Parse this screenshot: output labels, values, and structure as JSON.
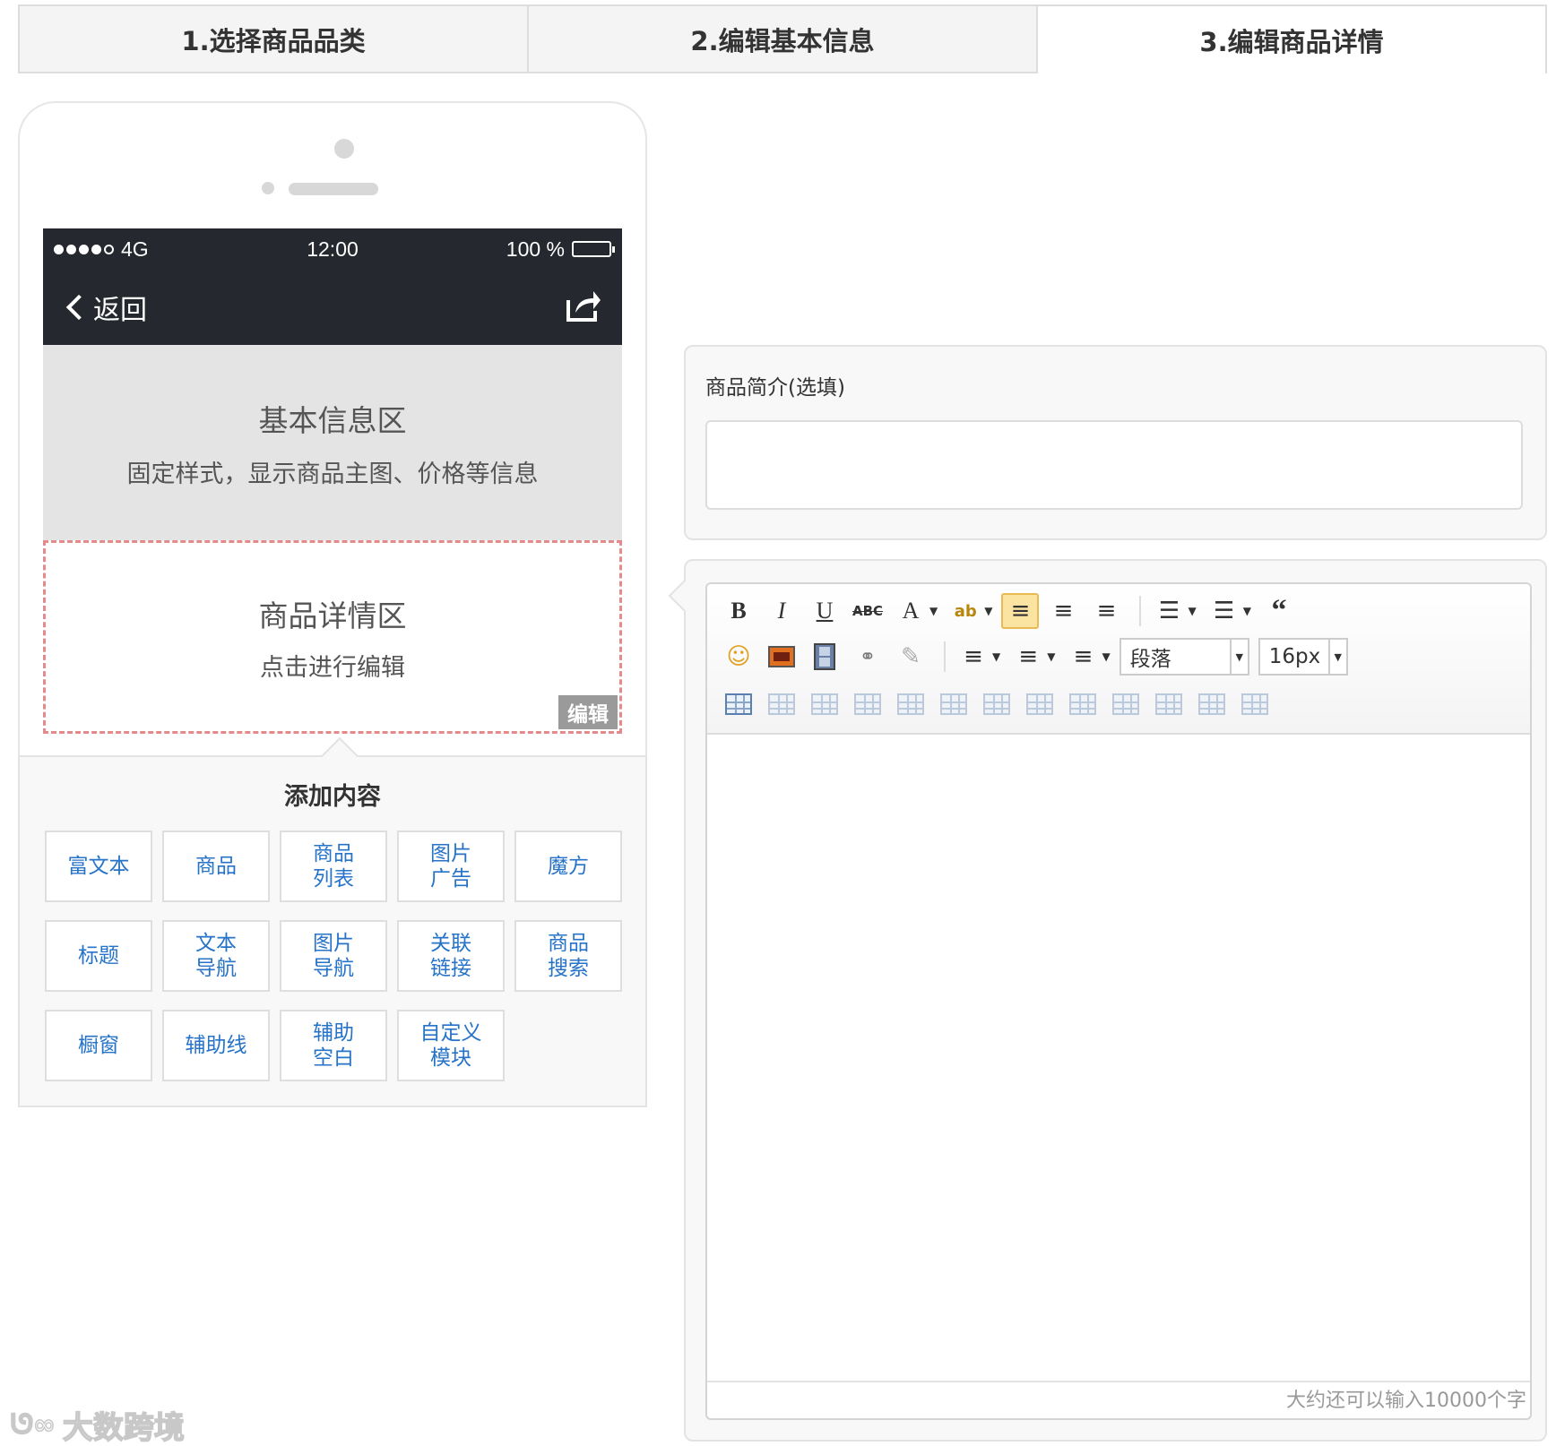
{
  "steps": [
    "1.选择商品品类",
    "2.编辑基本信息",
    "3.编辑商品详情"
  ],
  "phone": {
    "status": {
      "carrier": "4G",
      "time": "12:00",
      "battery": "100 %"
    },
    "nav": {
      "back": "返回",
      "share_icon": "share-icon"
    },
    "basic": {
      "title": "基本信息区",
      "subtitle": "固定样式，显示商品主图、价格等信息"
    },
    "detail": {
      "title": "商品详情区",
      "subtitle": "点击进行编辑",
      "edit_tag": "编辑"
    }
  },
  "add_content": {
    "title": "添加内容",
    "buttons": [
      "富文本",
      "商品",
      "商品\n列表",
      "图片\n广告",
      "魔方",
      "标题",
      "文本\n导航",
      "图片\n导航",
      "关联\n链接",
      "商品\n搜索",
      "橱窗",
      "辅助线",
      "辅助\n空白",
      "自定义\n模块"
    ]
  },
  "summary": {
    "label": "商品简介(选填)",
    "value": ""
  },
  "editor": {
    "paragraph": "段落",
    "font_size": "16px",
    "word_count": "大约还可以输入10000个字",
    "colors": {
      "active_bg": "#fbe3a1",
      "link": "#2673c8",
      "dark": "#25282e"
    }
  },
  "watermark": "大数跨境"
}
